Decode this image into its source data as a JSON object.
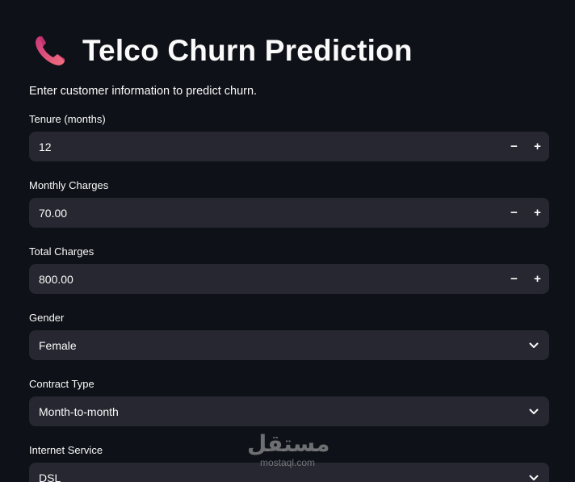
{
  "header": {
    "title": "Telco Churn Prediction",
    "icon": "telephone-receiver-icon",
    "icon_colors": [
      "#e0427a",
      "#f36b7f"
    ]
  },
  "intro_text": "Enter customer information to predict churn.",
  "fields": [
    {
      "label": "Tenure (months)",
      "value": "12",
      "kind": "number"
    },
    {
      "label": "Monthly Charges",
      "value": "70.00",
      "kind": "number"
    },
    {
      "label": "Total Charges",
      "value": "800.00",
      "kind": "number"
    },
    {
      "label": "Gender",
      "value": "Female",
      "kind": "select"
    },
    {
      "label": "Contract Type",
      "value": "Month-to-month",
      "kind": "select"
    },
    {
      "label": "Internet Service",
      "value": "DSL",
      "kind": "select"
    }
  ],
  "stepper": {
    "minus": "−",
    "plus": "+"
  },
  "watermark": {
    "arabic": "مستقل",
    "latin": "mostaql.com"
  },
  "colors": {
    "background": "#0e1117",
    "input_background": "#262730",
    "text": "#fafafa"
  }
}
